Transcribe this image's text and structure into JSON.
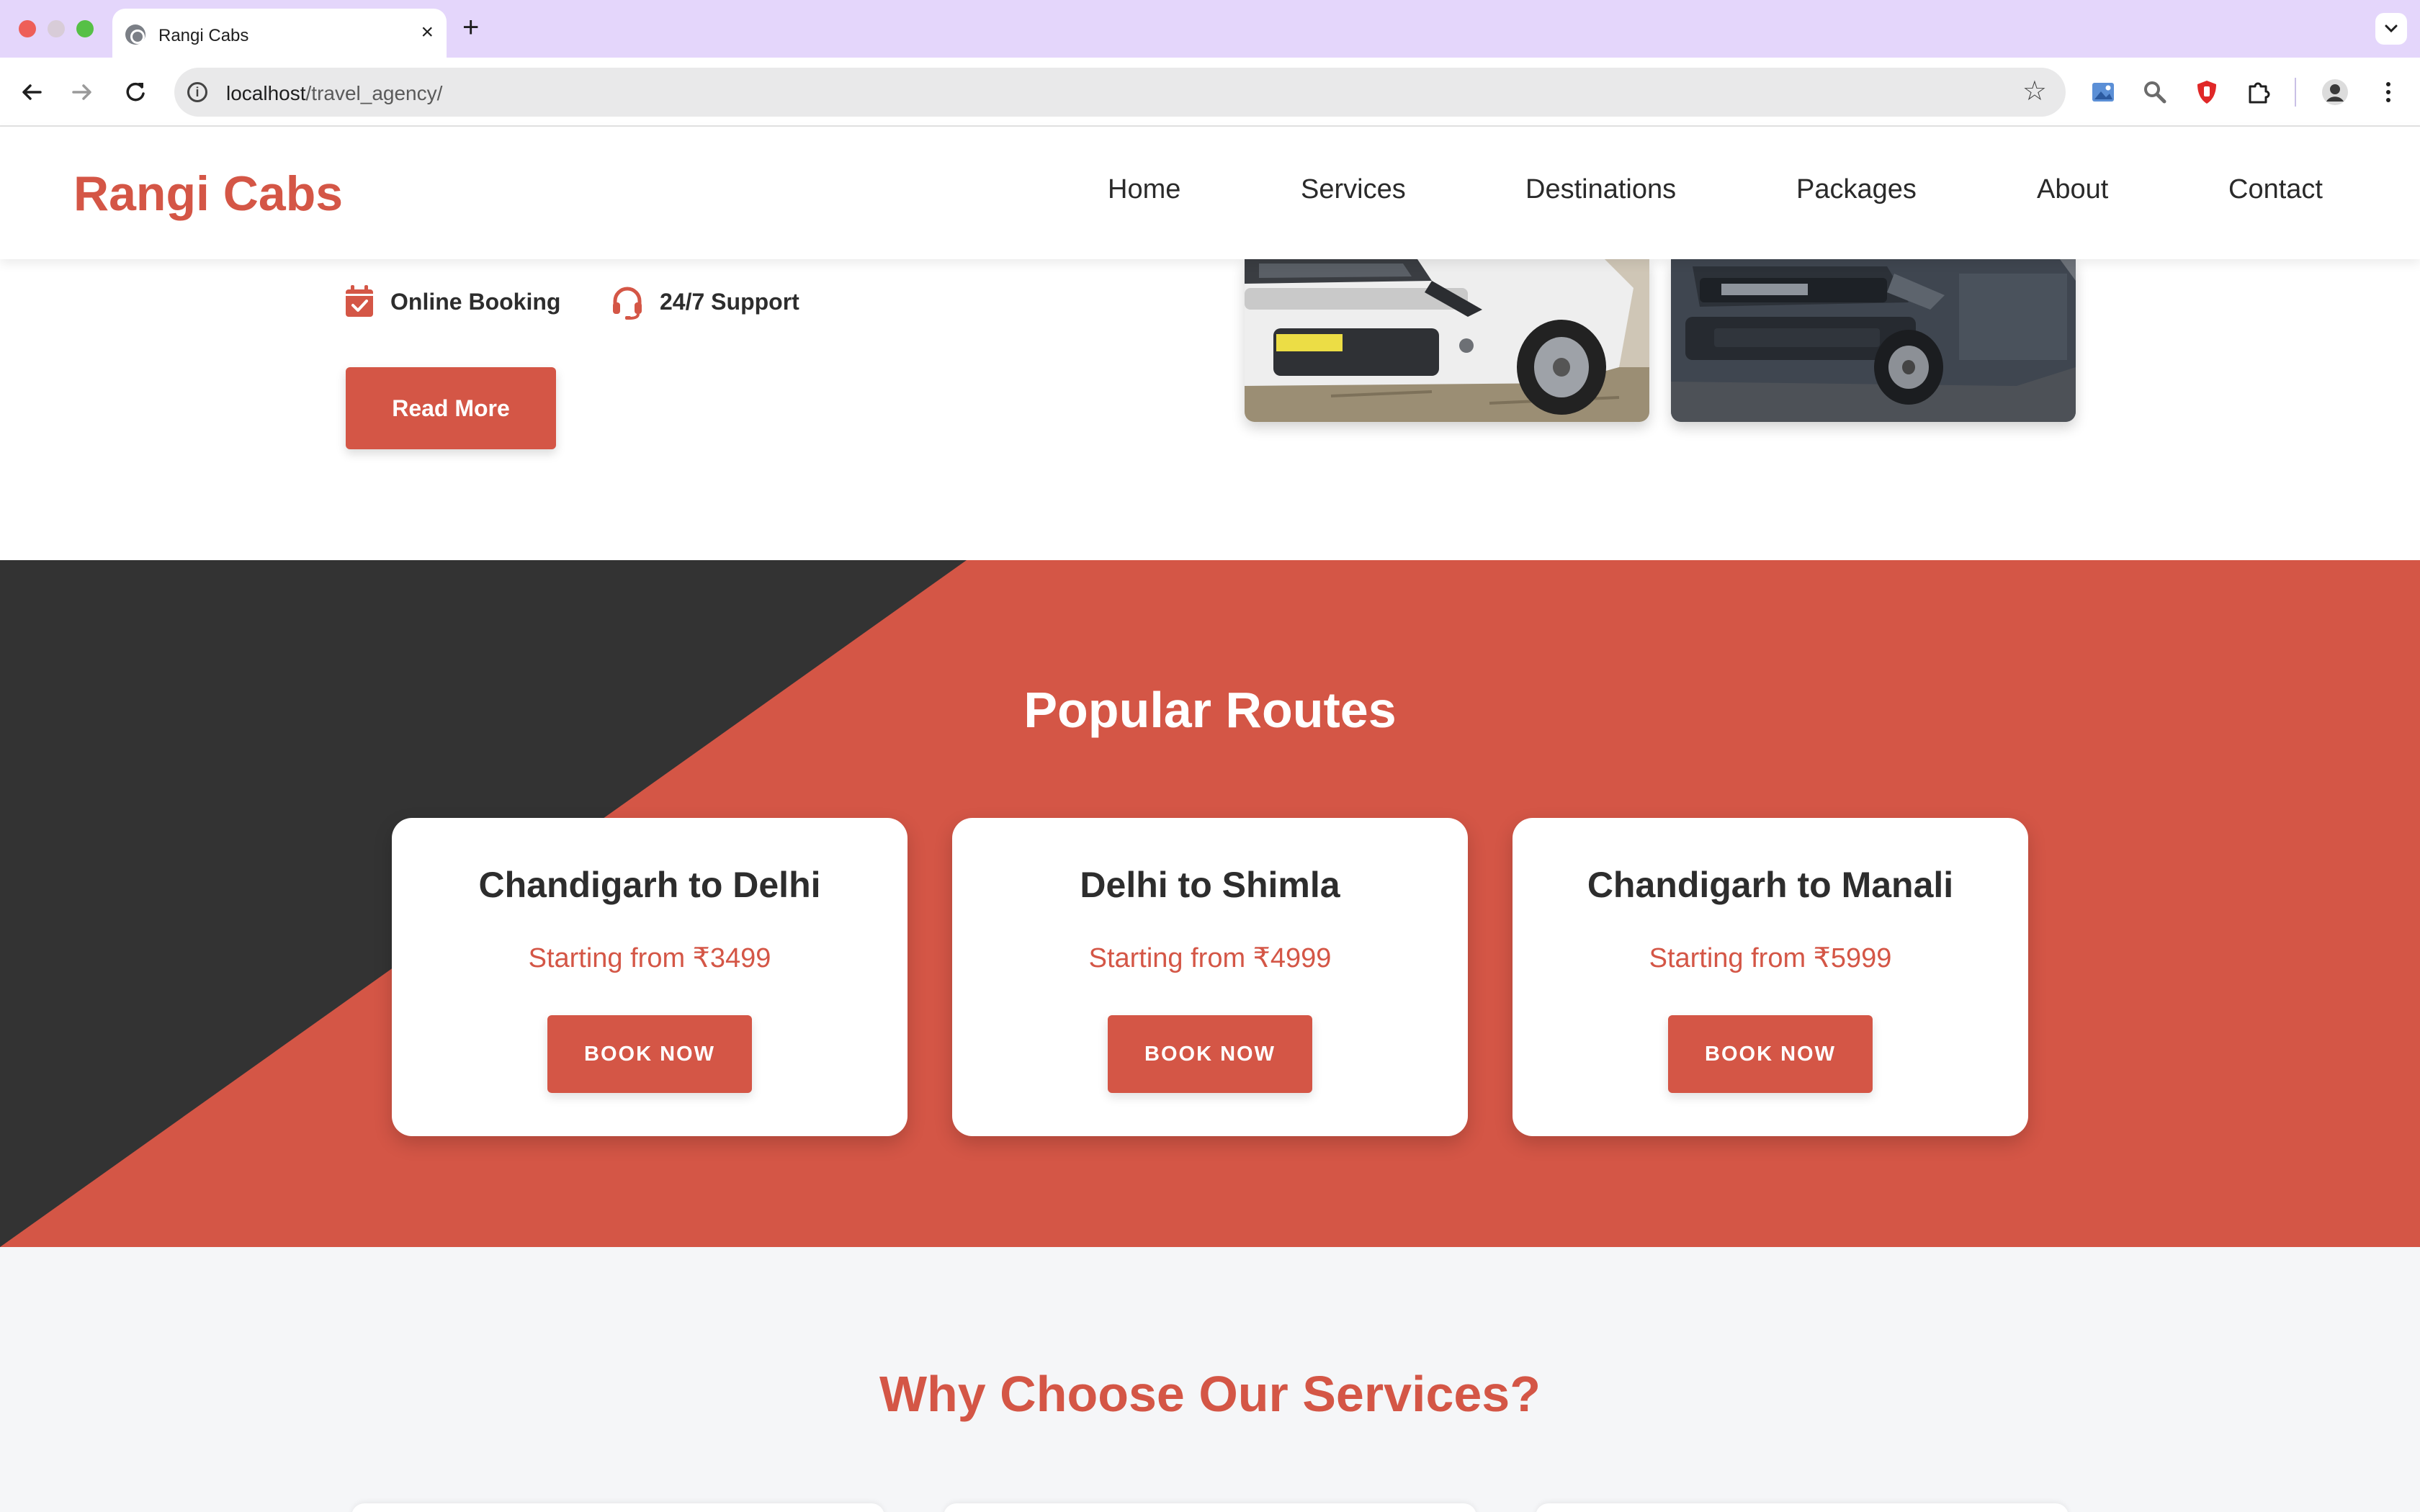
{
  "browser": {
    "tab_title": "Rangi Cabs",
    "tab_close": "×",
    "new_tab": "+",
    "url_host": "localhost",
    "url_path": "/travel_agency/"
  },
  "site": {
    "logo": "Rangi Cabs",
    "nav": [
      "Home",
      "Services",
      "Destinations",
      "Packages",
      "About",
      "Contact"
    ],
    "brand_color": "#d45646",
    "dark_color": "#333333"
  },
  "hero": {
    "features": [
      "Online Booking",
      "24/7 Support"
    ],
    "read_more": "Read More"
  },
  "routes": {
    "title": "Popular Routes",
    "items": [
      {
        "name": "Chandigarh to Delhi",
        "price": "Starting from ₹3499",
        "button": "BOOK NOW"
      },
      {
        "name": "Delhi to Shimla",
        "price": "Starting from ₹4999",
        "button": "BOOK NOW"
      },
      {
        "name": "Chandigarh to Manali",
        "price": "Starting from ₹5999",
        "button": "BOOK NOW"
      }
    ]
  },
  "why": {
    "title": "Why Choose Our Services?"
  }
}
